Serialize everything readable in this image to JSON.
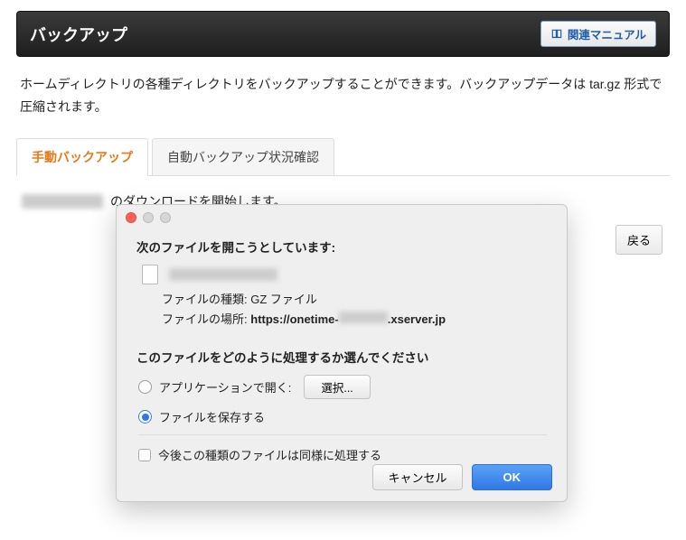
{
  "header": {
    "title": "バックアップ",
    "manual_button": "関連マニュアル"
  },
  "description": "ホームディレクトリの各種ディレクトリをバックアップすることができます。バックアップデータは tar.gz 形式で圧縮されます。",
  "tabs": {
    "0": {
      "label": "手動バックアップ"
    },
    "1": {
      "label": "自動バックアップ状況確認"
    }
  },
  "content": {
    "status_suffix": "のダウンロードを開始します。",
    "back_button": "戻る"
  },
  "dialog": {
    "heading": "次のファイルを開こうとしています:",
    "filetype_label": "ファイルの種類:",
    "filetype_value": "GZ ファイル",
    "filesrc_label": "ファイルの場所:",
    "host_prefix": "https://onetime-",
    "host_suffix": ".xserver.jp",
    "question": "このファイルをどのように処理するか選んでください",
    "open_with_label": "アプリケーションで開く:",
    "select_button": "選択...",
    "save_label": "ファイルを保存する",
    "remember_label": "今後この種類のファイルは同様に処理する",
    "cancel": "キャンセル",
    "ok": "OK"
  }
}
